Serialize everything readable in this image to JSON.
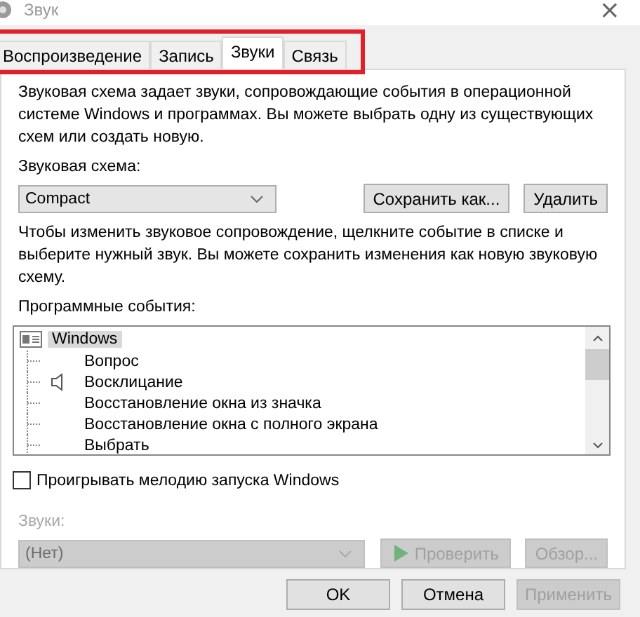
{
  "window": {
    "title": "Звук",
    "close": "×"
  },
  "tabs": [
    {
      "label": "Воспроизведение",
      "selected": false
    },
    {
      "label": "Запись",
      "selected": false
    },
    {
      "label": "Звуки",
      "selected": true
    },
    {
      "label": "Связь",
      "selected": false
    }
  ],
  "description": "Звуковая схема задает звуки, сопровождающие события в операционной системе Windows и программах. Вы можете выбрать одну из существующих схем или создать новую.",
  "scheme": {
    "label": "Звуковая схема:",
    "value": "Compact",
    "buttons": [
      {
        "label": "Сохранить как...",
        "disabled": false
      },
      {
        "label": "Удалить",
        "disabled": false
      }
    ]
  },
  "hint": "Чтобы изменить звуковое сопровождение, щелкните событие в списке и выберите нужный звук. Вы можете сохранить изменения как новую звуковую схему.",
  "events": {
    "label": "Программные события:",
    "items": [
      {
        "label": "Windows",
        "selected": true,
        "children": [
          {
            "label": "Вопрос",
            "has_sound": false
          },
          {
            "label": "Восклицание",
            "has_sound": true
          },
          {
            "label": "Восстановление окна из значка",
            "has_sound": false
          },
          {
            "label": "Восстановление окна с полного экрана",
            "has_sound": false
          },
          {
            "label": "Выбрать",
            "has_sound": false
          }
        ]
      }
    ]
  },
  "startup_checkbox": {
    "label": "Проигрывать мелодию запуска Windows",
    "checked": false
  },
  "sounds": {
    "label": "Звуки:",
    "value": "(Нет)",
    "disabled": true,
    "test": {
      "label": "Проверить",
      "disabled": true
    },
    "browse": {
      "label": "Обзор...",
      "disabled": true
    }
  },
  "footer_buttons": [
    {
      "label": "OK",
      "disabled": false
    },
    {
      "label": "Отмена",
      "disabled": false
    },
    {
      "label": "Применить",
      "disabled": true
    }
  ]
}
